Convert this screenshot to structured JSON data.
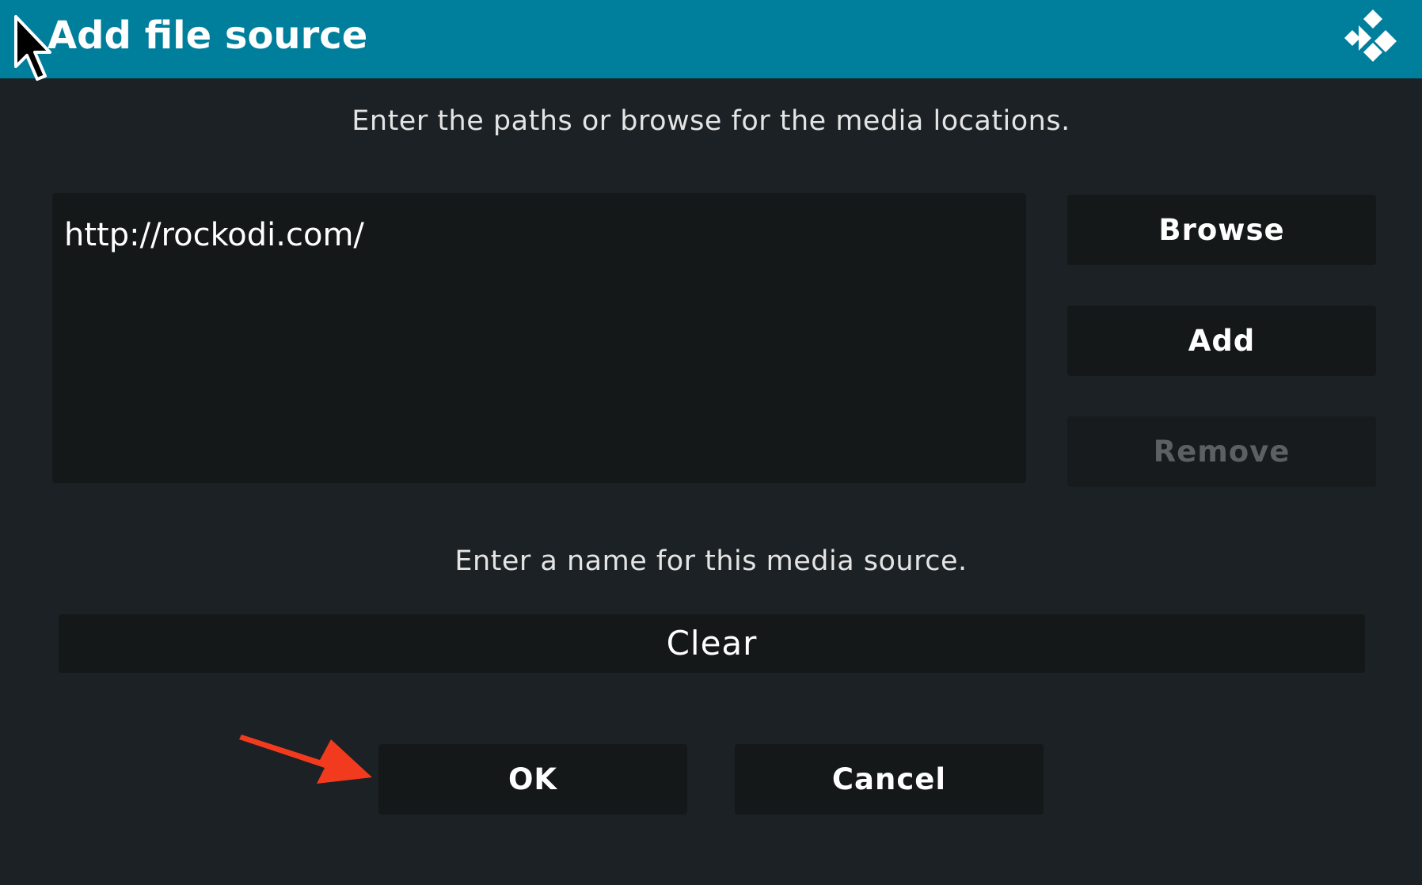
{
  "header": {
    "title": "Add file source",
    "logo_icon": "kodi-logo-icon",
    "background_color": "#007f9c"
  },
  "paths_section": {
    "prompt": "Enter the paths or browse for the media locations.",
    "items": [
      "http://rockodi.com/"
    ]
  },
  "side_buttons": {
    "browse_label": "Browse",
    "add_label": "Add",
    "remove_label": "Remove"
  },
  "name_section": {
    "prompt": "Enter a name for this media source.",
    "value": "Clear"
  },
  "actions": {
    "ok_label": "OK",
    "cancel_label": "Cancel"
  },
  "annotation": {
    "arrow_color": "#f23a1e",
    "cursor_icon": "mouse-pointer-icon"
  }
}
